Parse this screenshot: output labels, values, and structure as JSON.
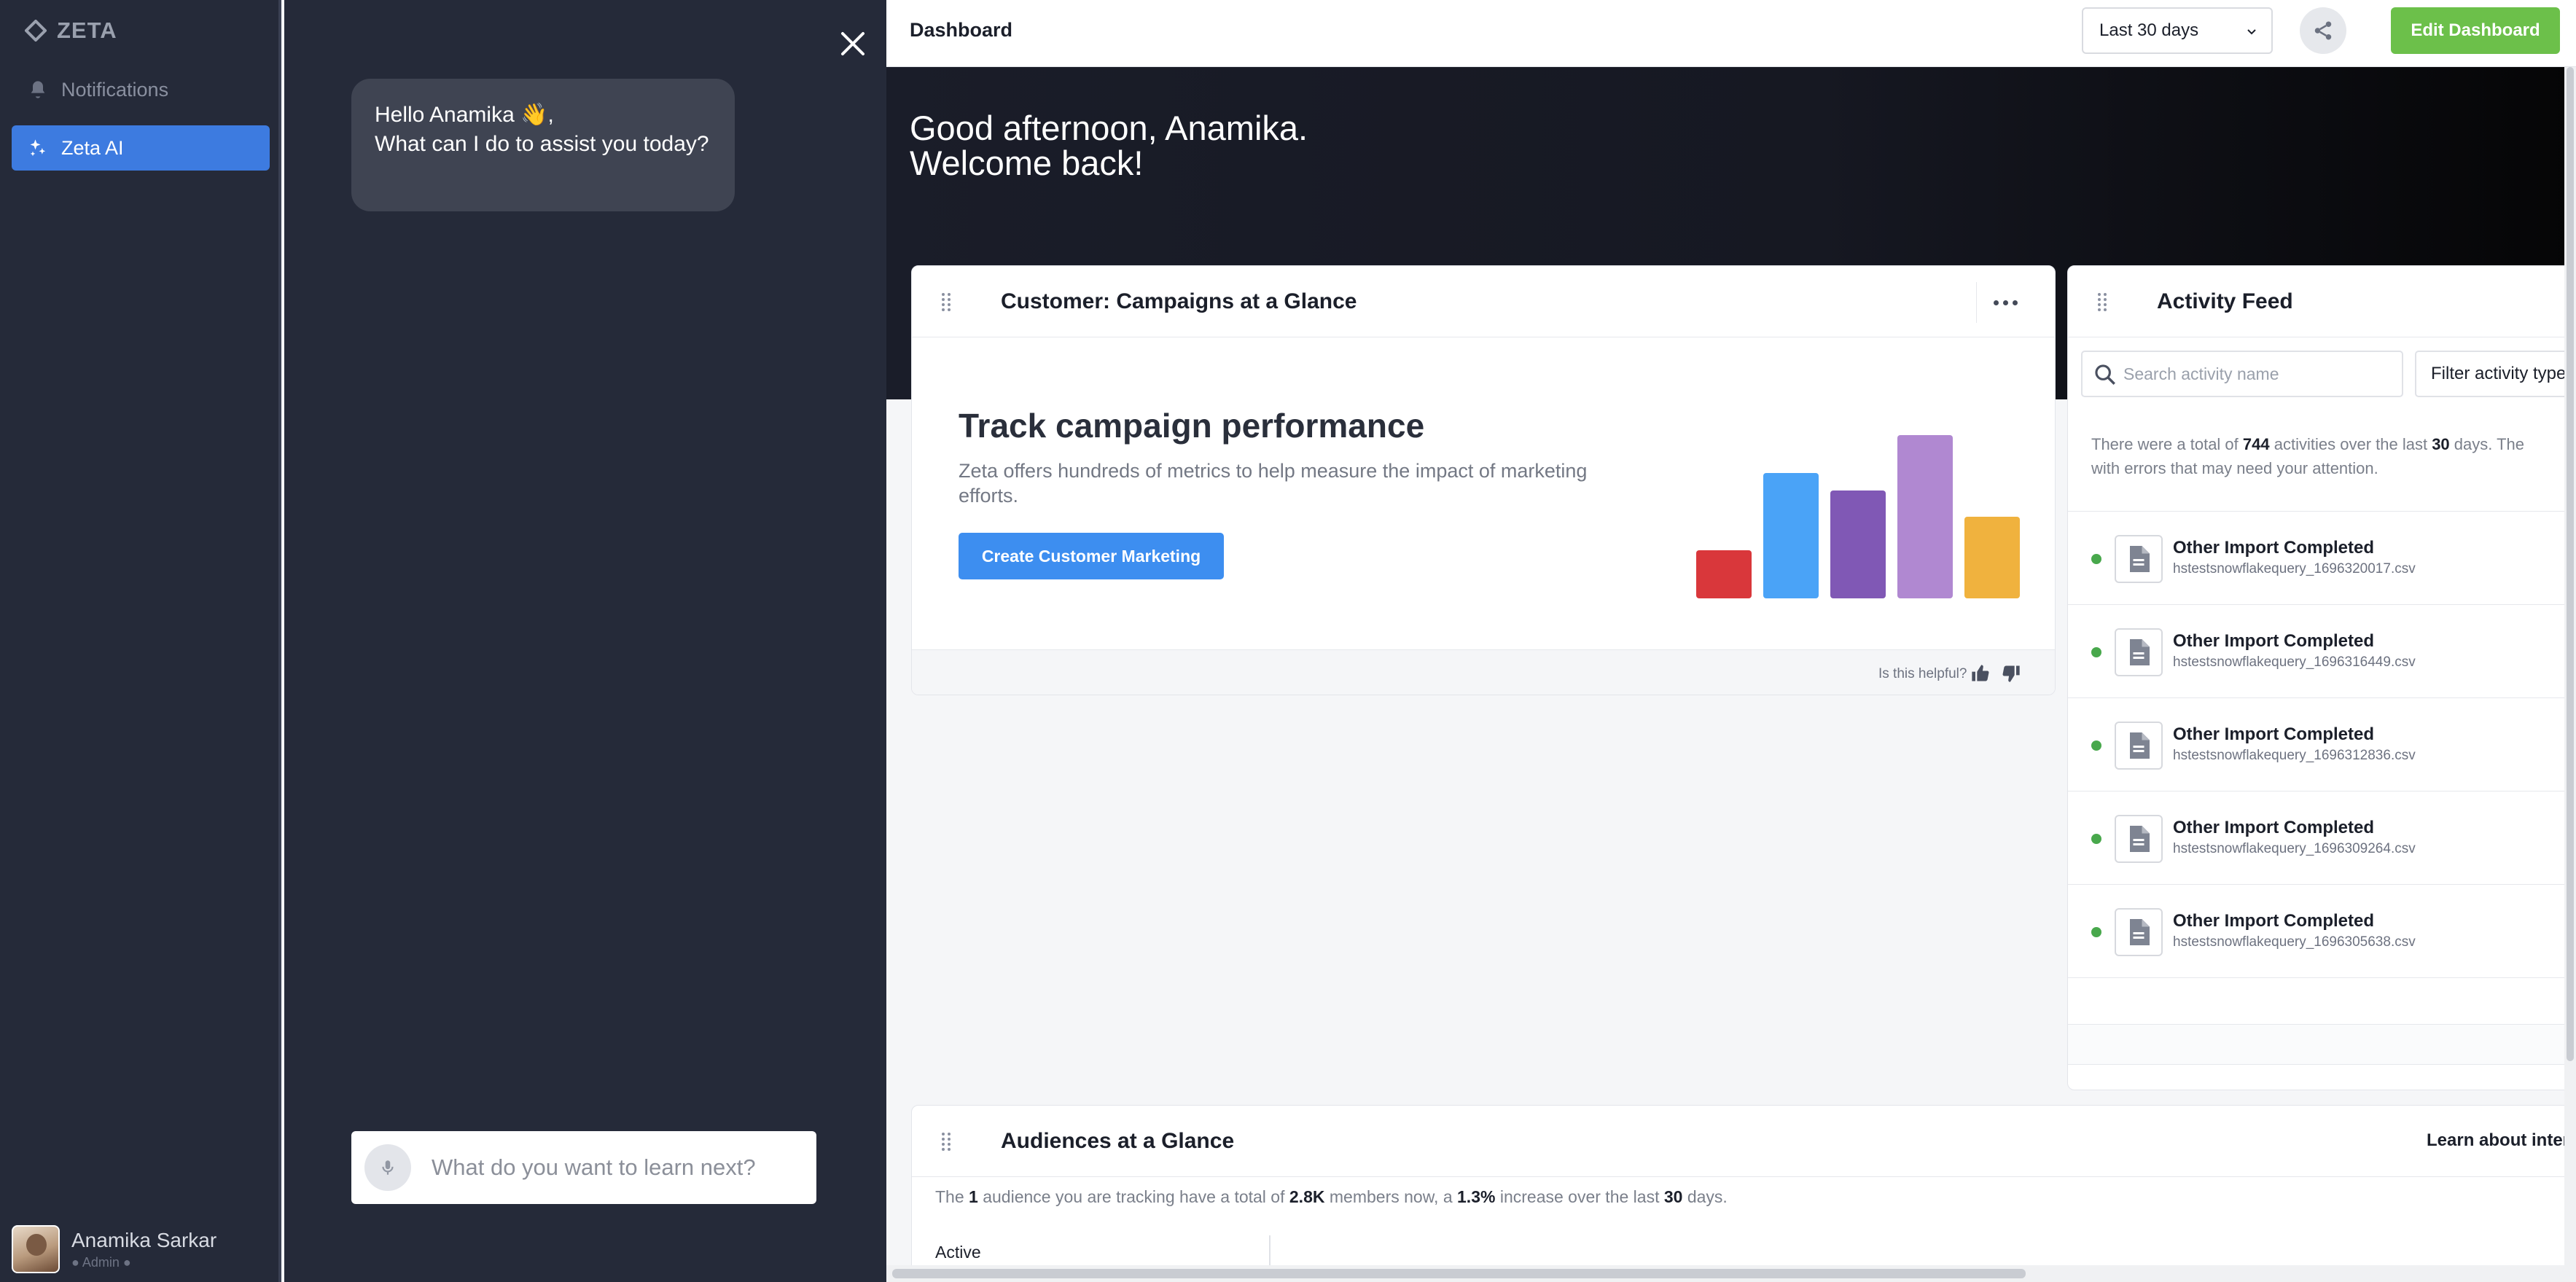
{
  "nav": {
    "brand": "ZETA",
    "items": [
      {
        "label": "Notifications",
        "icon": "bell-icon"
      },
      {
        "label": "Zeta AI",
        "icon": "sparkle-icon",
        "active": true
      }
    ],
    "user": {
      "name": "Anamika Sarkar",
      "role": "Admin"
    }
  },
  "chat": {
    "greeting_line1": "Hello Anamika 👋,",
    "greeting_line2": "What can I do to assist you today?",
    "input_placeholder": "What do you want to learn next?"
  },
  "header": {
    "title": "Dashboard",
    "date_range": "Last 30 days",
    "edit_label": "Edit Dashboard"
  },
  "hero": {
    "line1": "Good afternoon, Anamika.",
    "line2": "Welcome back!"
  },
  "campaign_card": {
    "title": "Customer: Campaigns at a Glance",
    "heading": "Track campaign performance",
    "description": "Zeta offers hundreds of metrics to help measure the impact of marketing efforts.",
    "button": "Create Customer Marketing",
    "helpful_text": "Is this helpful?",
    "illustration_colors": [
      "#d9373b",
      "#4aa3f7",
      "#8058b5",
      "#b088d1",
      "#f0b23e"
    ]
  },
  "activity_card": {
    "title": "Activity Feed",
    "search_placeholder": "Search activity name",
    "filter_label": "Filter activity type",
    "summary_prefix": "There were a total of",
    "summary_count": "744",
    "summary_middle": "activities over the last",
    "summary_days": "30",
    "summary_suffix": "days. The",
    "summary_line2": "with errors that may need your attention.",
    "items": [
      {
        "title": "Other Import Completed",
        "file": "hstestsnowflakequery_1696320017.csv"
      },
      {
        "title": "Other Import Completed",
        "file": "hstestsnowflakequery_1696316449.csv"
      },
      {
        "title": "Other Import Completed",
        "file": "hstestsnowflakequery_1696312836.csv"
      },
      {
        "title": "Other Import Completed",
        "file": "hstestsnowflakequery_1696309264.csv"
      },
      {
        "title": "Other Import Completed",
        "file": "hstestsnowflakequery_1696305638.csv"
      }
    ]
  },
  "audience_card": {
    "title": "Audiences at a Glance",
    "learn_link": "Learn about intended",
    "summary_p1": "The",
    "summary_count": "1",
    "summary_p2": "audience you are tracking have a total of",
    "summary_members": "2.8K",
    "summary_p3": "members now, a",
    "summary_pct": "1.3%",
    "summary_p4": "increase over the last",
    "summary_days": "30",
    "summary_p5": "days.",
    "column_label": "Active"
  },
  "colors": {
    "accent": "#3d7be0",
    "primary_button": "#3d8ef0",
    "edit_button": "#6cc04a",
    "status_ok": "#48a84c",
    "nav_bg": "#252a39"
  }
}
